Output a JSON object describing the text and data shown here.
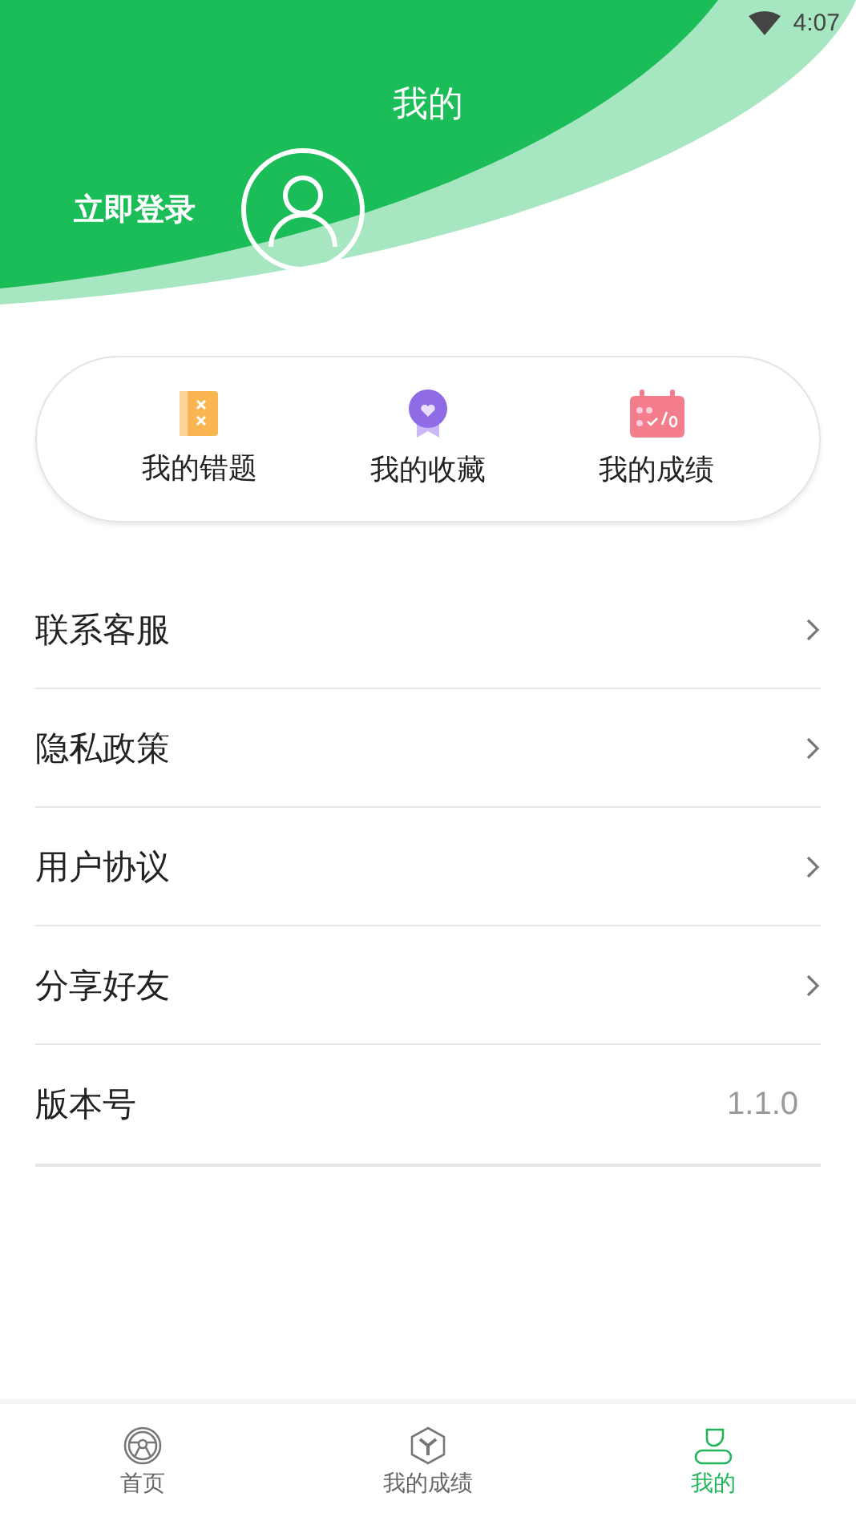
{
  "status_bar": {
    "time": "4:07"
  },
  "header": {
    "title": "我的",
    "login": "立即登录"
  },
  "shortcuts": [
    {
      "label": "我的错题"
    },
    {
      "label": "我的收藏"
    },
    {
      "label": "我的成绩"
    }
  ],
  "menu": [
    {
      "kind": "link",
      "label": "联系客服"
    },
    {
      "kind": "link",
      "label": "隐私政策"
    },
    {
      "kind": "link",
      "label": "用户协议"
    },
    {
      "kind": "link",
      "label": "分享好友"
    },
    {
      "kind": "value",
      "label": "版本号",
      "value": "1.1.0"
    }
  ],
  "tabs": [
    {
      "label": "首页",
      "selected": false
    },
    {
      "label": "我的成绩",
      "selected": false
    },
    {
      "label": "我的",
      "selected": true
    }
  ]
}
